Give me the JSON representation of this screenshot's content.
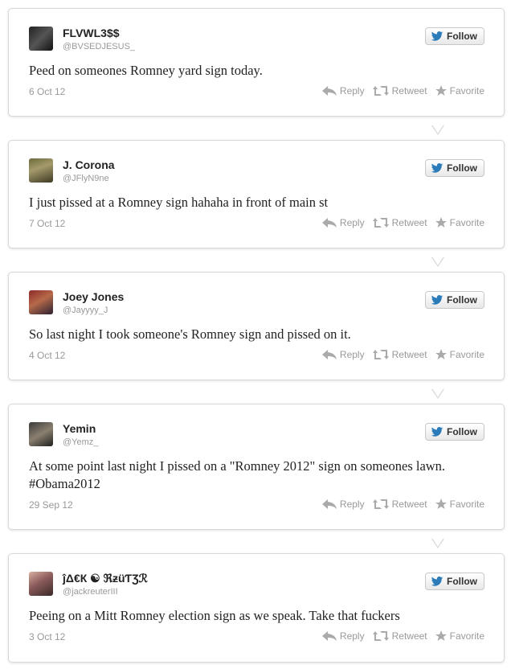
{
  "ui": {
    "follow_label": "Follow",
    "reply_label": "Reply",
    "retweet_label": "Retweet",
    "favorite_label": "Favorite",
    "accent": "#2b7bb9",
    "icon_gray": "#aaaaaa"
  },
  "tweets": [
    {
      "name": "FLVWL3$$",
      "handle": "@BVSEDJESUS_",
      "text": "Peed on someones Romney yard sign today.",
      "date": "6 Oct 12",
      "avatar_icon": "avatar-image"
    },
    {
      "name": "J. Corona",
      "handle": "@JFlyN9ne",
      "text": "I just pissed at a Romney sign hahaha in front of main st",
      "date": "7 Oct 12",
      "avatar_icon": "avatar-image"
    },
    {
      "name": "Joey Jones",
      "handle": "@Jayyyy_J",
      "text": "So last night I took someone's Romney sign and pissed on it.",
      "date": "4 Oct 12",
      "avatar_icon": "avatar-image"
    },
    {
      "name": "Yemin",
      "handle": "@Yemz_",
      "text": "At some point last night I pissed on a \"Romney 2012\" sign on someones lawn.",
      "text2": "#Obama2012",
      "date": "29 Sep 12",
      "avatar_icon": "avatar-image"
    },
    {
      "name": "ĵΔ€К ☯ ℜƶüƬƷℛ",
      "handle": "@jackreuterIII",
      "text": "Peeing on a Mitt Romney election sign as we speak. Take that fuckers",
      "date": "3 Oct 12",
      "avatar_icon": "avatar-image"
    }
  ]
}
